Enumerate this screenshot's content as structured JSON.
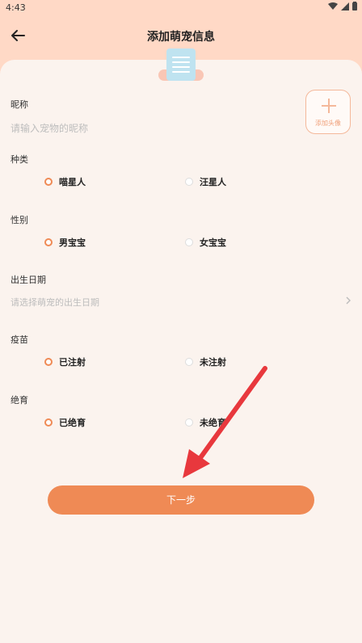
{
  "status_bar": {
    "time": "4:43"
  },
  "header": {
    "title": "添加萌宠信息"
  },
  "nickname": {
    "label": "昵称",
    "placeholder": "请输入宠物的昵称"
  },
  "avatar": {
    "label": "添加头像"
  },
  "species": {
    "label": "种类",
    "options": [
      "喵星人",
      "汪星人"
    ],
    "selected": "喵星人"
  },
  "gender": {
    "label": "性别",
    "options": [
      "男宝宝",
      "女宝宝"
    ],
    "selected": "男宝宝"
  },
  "birthday": {
    "label": "出生日期",
    "placeholder": "请选择萌宠的出生日期"
  },
  "vaccine": {
    "label": "疫苗",
    "options": [
      "已注射",
      "未注射"
    ],
    "selected": "已注射"
  },
  "neutered": {
    "label": "绝育",
    "options": [
      "已绝育",
      "未绝育"
    ],
    "selected": "已绝育"
  },
  "next_button": {
    "label": "下一步"
  },
  "colors": {
    "accent": "#ef8a55",
    "header_bg": "#ffd9c6",
    "page_bg": "#fbf3ee",
    "annotation_arrow": "#e8383d"
  },
  "icons": [
    "back-arrow-icon",
    "wifi-icon",
    "cellular-icon",
    "battery-icon",
    "clipboard-icon",
    "plus-icon",
    "chevron-right-icon"
  ]
}
